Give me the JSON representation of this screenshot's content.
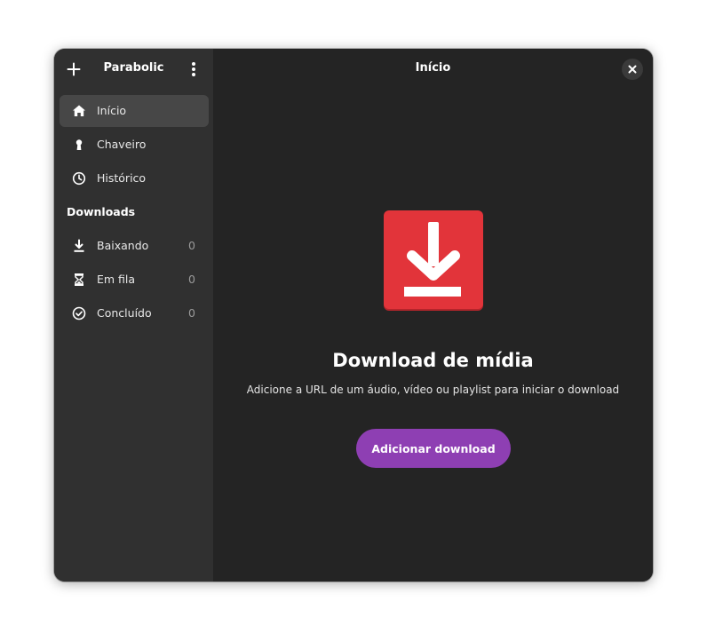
{
  "sidebar": {
    "app_title": "Parabolic",
    "add_icon": "plus-icon",
    "menu_icon": "vertical-dots-icon",
    "nav": [
      {
        "label": "Início",
        "icon": "home-icon",
        "active": true
      },
      {
        "label": "Chaveiro",
        "icon": "keyhole-icon",
        "active": false
      },
      {
        "label": "Histórico",
        "icon": "clock-icon",
        "active": false
      }
    ],
    "section_title": "Downloads",
    "downloads": [
      {
        "label": "Baixando",
        "icon": "download-icon",
        "count": "0"
      },
      {
        "label": "Em fila",
        "icon": "hourglass-icon",
        "count": "0"
      },
      {
        "label": "Concluído",
        "icon": "check-circle-icon",
        "count": "0"
      }
    ]
  },
  "main": {
    "title": "Início",
    "close_icon": "close-icon",
    "hero_title": "Download de mídia",
    "hero_description": "Adicione a URL de um áudio, vídeo ou playlist para iniciar o download",
    "add_button_label": "Adicionar download"
  },
  "colors": {
    "accent": "#8e3fb3",
    "hero_icon": "#e2343a",
    "sidebar_bg": "#303030",
    "main_bg": "#242424",
    "active_item_bg": "#474747"
  }
}
